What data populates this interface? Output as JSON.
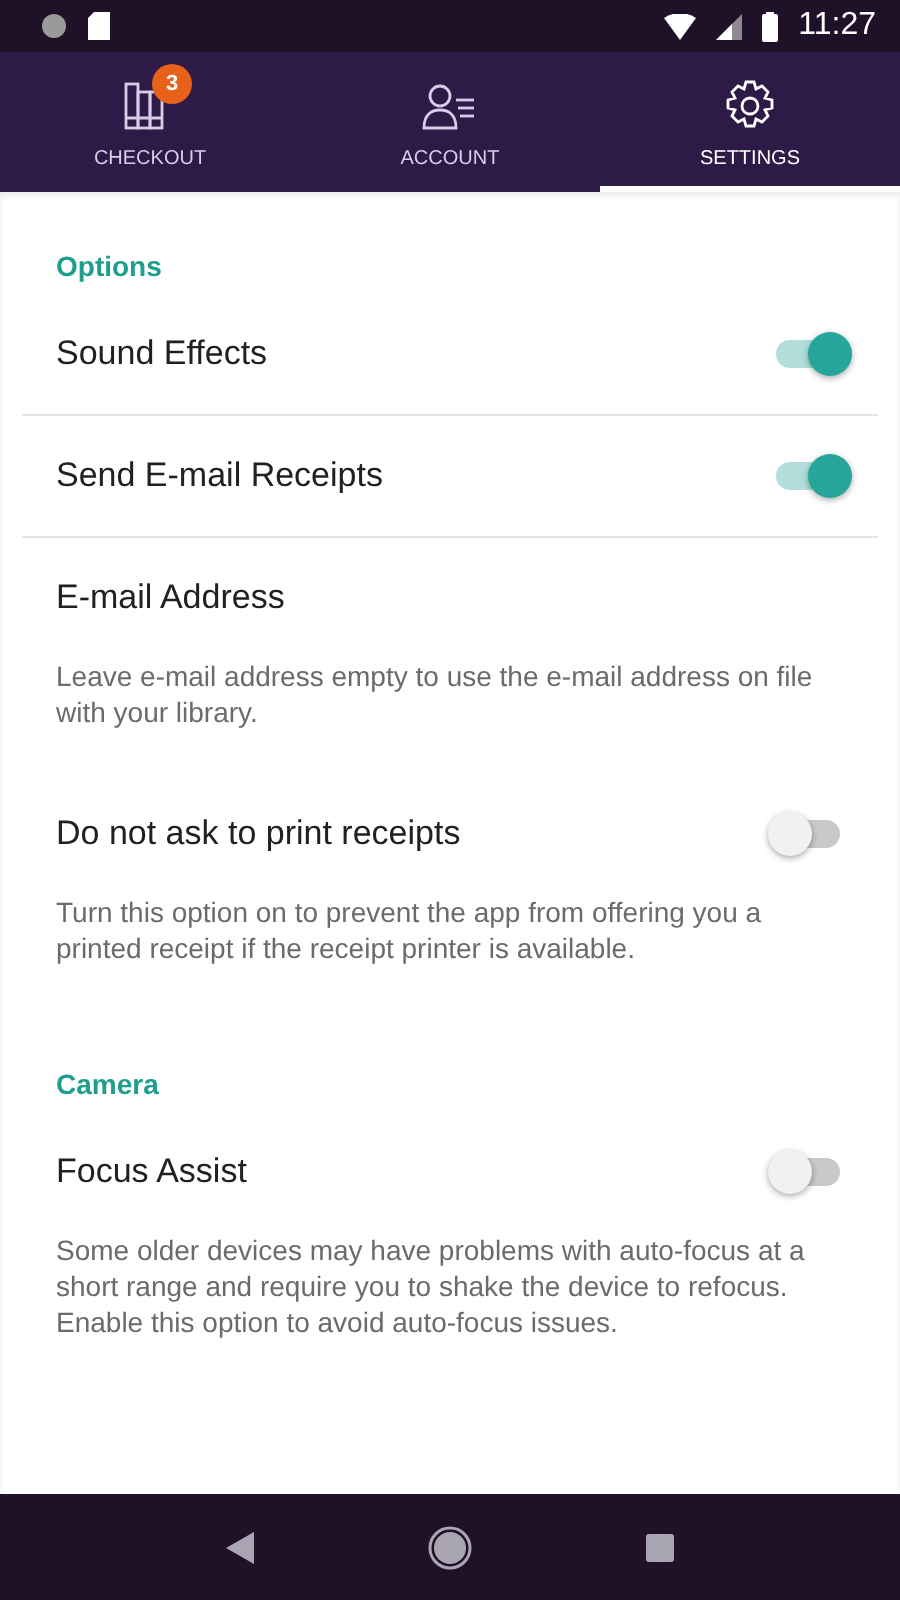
{
  "status_bar": {
    "time": "11:27"
  },
  "tabs": [
    {
      "label": "CHECKOUT",
      "badge": "3",
      "selected": false
    },
    {
      "label": "ACCOUNT",
      "selected": false
    },
    {
      "label": "SETTINGS",
      "selected": true
    }
  ],
  "sections": [
    {
      "title": "Options",
      "items": [
        {
          "kind": "toggle",
          "label": "Sound Effects",
          "on": true,
          "divider": true
        },
        {
          "kind": "toggle",
          "label": "Send E-mail Receipts",
          "on": true,
          "divider": true
        },
        {
          "kind": "text",
          "label": "E-mail Address",
          "divider": false,
          "description": "Leave e-mail address empty to use the e-mail address on file with your library."
        },
        {
          "kind": "toggle",
          "label": "Do not ask to print receipts",
          "on": false,
          "divider": false,
          "description": "Turn this option on to prevent the app from offering you a printed receipt if the receipt printer is available."
        }
      ]
    },
    {
      "title": "Camera",
      "items": [
        {
          "kind": "toggle",
          "label": "Focus Assist",
          "on": false,
          "divider": false,
          "description": "Some older devices may have problems with auto-focus at a short range and require you to shake the device to refocus. Enable this option to avoid auto-focus issues."
        }
      ]
    }
  ]
}
